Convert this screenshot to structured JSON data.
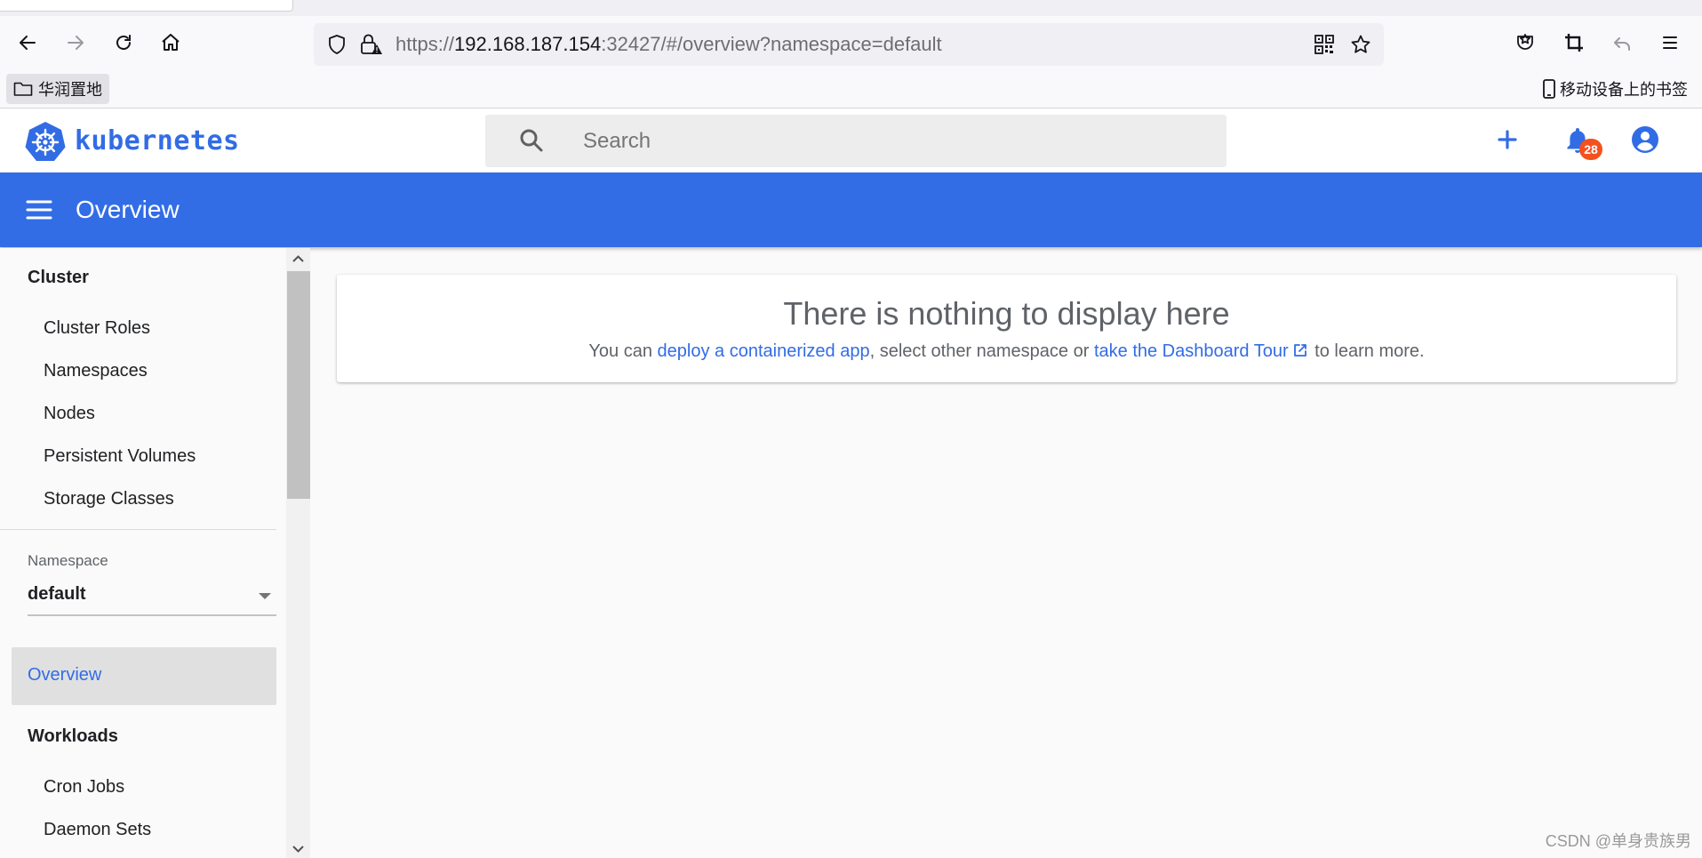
{
  "browser": {
    "url_prefix": "https://",
    "url_host": "192.168.187.154",
    "url_rest": ":32427/#/overview?namespace=default",
    "bookmarks": {
      "folder_label": "华润置地",
      "mobile_label": "移动设备上的书签"
    },
    "icons": [
      "back-icon",
      "forward-icon",
      "reload-icon",
      "home-icon",
      "shield-icon",
      "lock-warning-icon",
      "qr-code-icon",
      "bookmark-star-icon",
      "pocket-icon",
      "screenshot-crop-icon",
      "undo-icon",
      "hamburger-menu-icon"
    ]
  },
  "header": {
    "brand": "kubernetes",
    "search_placeholder": "Search",
    "notifications_count": "28",
    "accent_color": "#326ce5"
  },
  "toolbar": {
    "title": "Overview",
    "bg_color": "#326de6"
  },
  "sidebar": {
    "cluster": {
      "title": "Cluster",
      "items": [
        "Cluster Roles",
        "Namespaces",
        "Nodes",
        "Persistent Volumes",
        "Storage Classes"
      ]
    },
    "namespace": {
      "label": "Namespace",
      "selected": "default"
    },
    "active_item": "Overview",
    "workloads": {
      "title": "Workloads",
      "items": [
        "Cron Jobs",
        "Daemon Sets"
      ]
    }
  },
  "main": {
    "empty_title": "There is nothing to display here",
    "desc_prefix": "You can ",
    "link_deploy": "deploy a containerized app",
    "desc_middle": ", select other namespace or ",
    "link_tour": "take the Dashboard Tour",
    "desc_suffix": " to learn more."
  },
  "watermark": "CSDN @单身贵族男"
}
